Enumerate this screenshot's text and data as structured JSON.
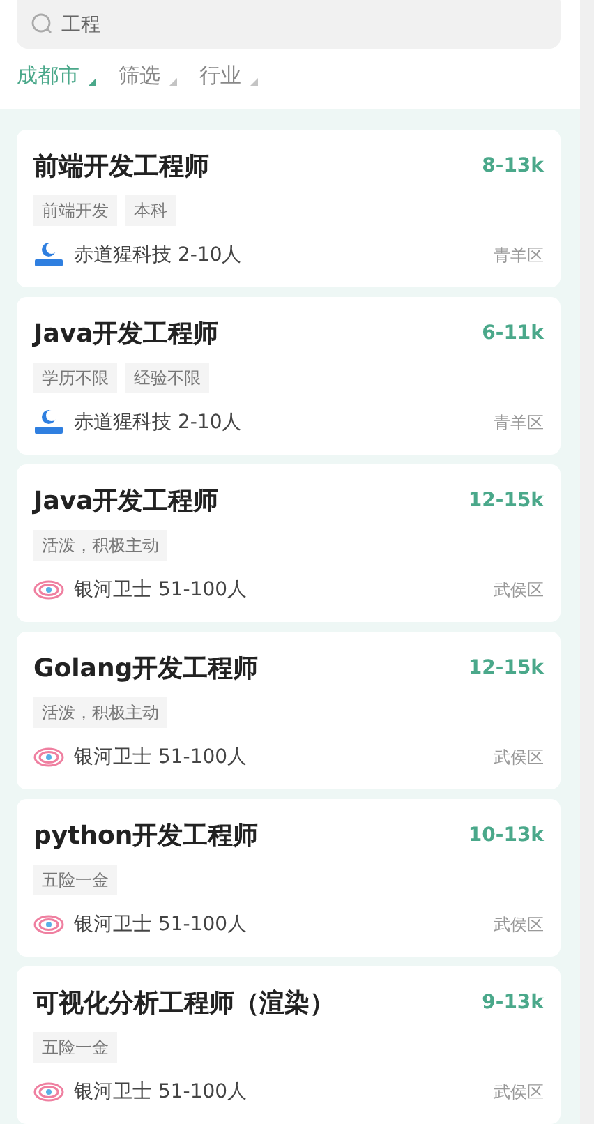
{
  "search": {
    "value": "工程"
  },
  "filters": [
    {
      "label": "成都市",
      "selected": true
    },
    {
      "label": "筛选",
      "selected": false
    },
    {
      "label": "行业",
      "selected": false
    }
  ],
  "jobs": [
    {
      "title": "前端开发工程师",
      "salary": "8-13k",
      "tags": [
        "前端开发",
        "本科"
      ],
      "company": "赤道猩科技 2-10人",
      "kind": "crescent",
      "district": "青羊区"
    },
    {
      "title": "Java开发工程师",
      "salary": "6-11k",
      "tags": [
        "学历不限",
        "经验不限"
      ],
      "company": "赤道猩科技 2-10人",
      "kind": "crescent",
      "district": "青羊区"
    },
    {
      "title": "Java开发工程师",
      "salary": "12-15k",
      "tags": [
        "活泼，积极主动"
      ],
      "company": "银河卫士 51-100人",
      "kind": "swirl",
      "district": "武侯区"
    },
    {
      "title": "Golang开发工程师",
      "salary": "12-15k",
      "tags": [
        "活泼，积极主动"
      ],
      "company": "银河卫士 51-100人",
      "kind": "swirl",
      "district": "武侯区"
    },
    {
      "title": "python开发工程师",
      "salary": "10-13k",
      "tags": [
        "五险一金"
      ],
      "company": "银河卫士 51-100人",
      "kind": "swirl",
      "district": "武侯区"
    },
    {
      "title": "可视化分析工程师（渲染）",
      "salary": "9-13k",
      "tags": [
        "五险一金"
      ],
      "company": "银河卫士 51-100人",
      "kind": "swirl",
      "district": "武侯区"
    }
  ]
}
